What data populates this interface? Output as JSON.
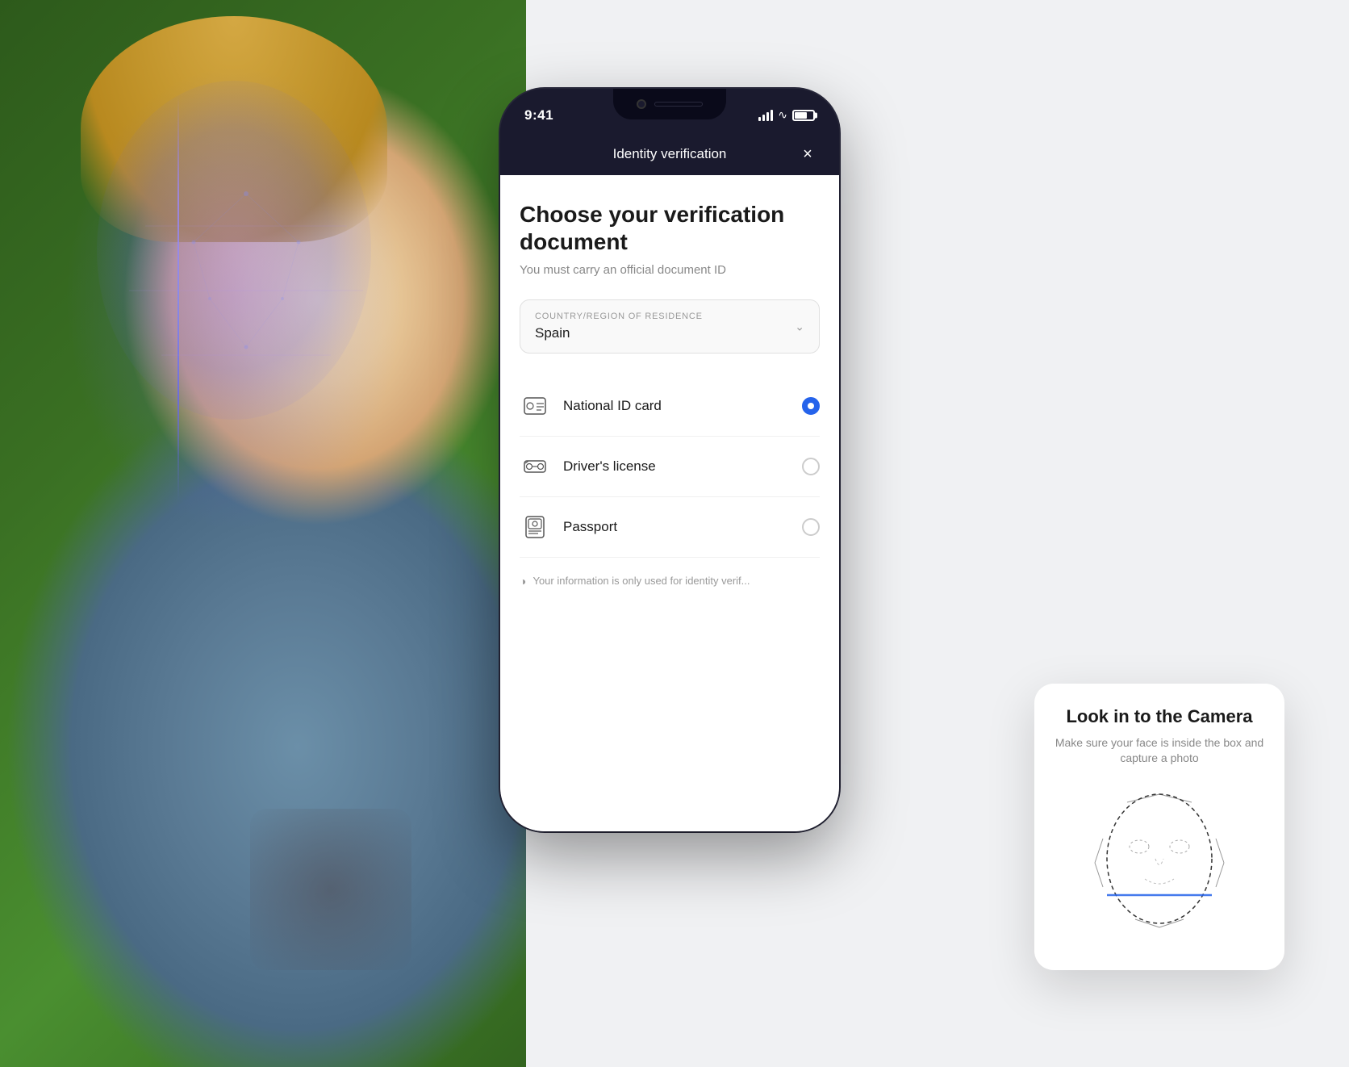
{
  "background": {
    "color": "#e8eaec"
  },
  "phone": {
    "status_bar": {
      "time": "9:41",
      "signal": "signal",
      "wifi": "wifi",
      "battery": "battery"
    },
    "header": {
      "title": "Identity verification",
      "close_label": "×"
    },
    "content": {
      "page_title": "Choose your verification document",
      "page_subtitle": "You must carry an official document ID",
      "country_label": "COUNTRY/REGION OF RESIDENCE",
      "country_value": "Spain",
      "documents": [
        {
          "id": "national-id",
          "label": "National ID card",
          "icon": "🪪",
          "selected": true
        },
        {
          "id": "drivers-license",
          "label": "Driver's license",
          "icon": "🚗",
          "selected": false
        },
        {
          "id": "passport",
          "label": "Passport",
          "icon": "📋",
          "selected": false
        }
      ],
      "info_text": "Your information is only used for identity verif..."
    }
  },
  "camera_card": {
    "title": "Look in to the Camera",
    "subtitle": "Make sure your face is inside the box and capture a photo"
  },
  "colors": {
    "selected_blue": "#2563eb",
    "text_primary": "#1a1a1a",
    "text_secondary": "#888888",
    "border": "#e0e0e0"
  }
}
